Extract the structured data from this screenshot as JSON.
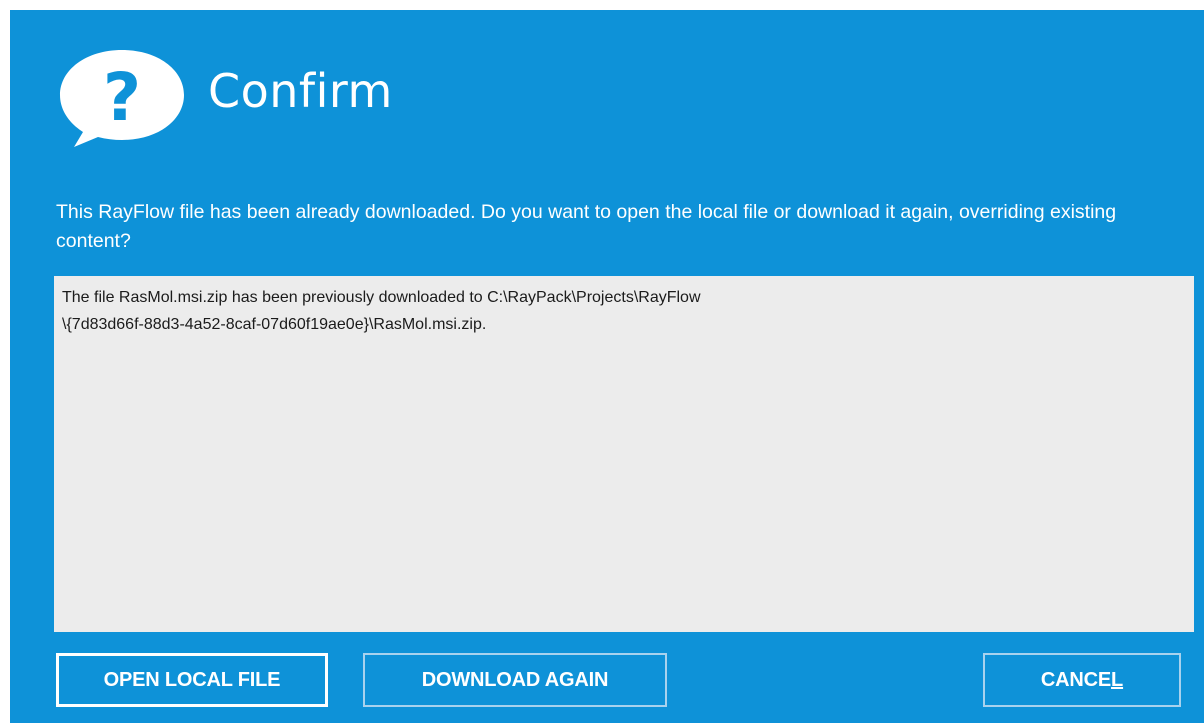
{
  "dialog": {
    "title": "Confirm",
    "icon": "question-speech-bubble-icon",
    "message": "This RayFlow file has been already downloaded. Do you want to open the local file or download it again, overriding existing content?",
    "details_line1": "The file RasMol.msi.zip has been previously downloaded to C:\\RayPack\\Projects\\RayFlow",
    "details_line2": "\\{7d83d66f-88d3-4a52-8caf-07d60f19ae0e}\\RasMol.msi.zip."
  },
  "buttons": {
    "open_local_file": "OPEN LOCAL FILE",
    "download_again": "DOWNLOAD AGAIN",
    "cancel_prefix": "CANCE",
    "cancel_mnemonic": "L"
  },
  "colors": {
    "background": "#0e92d8",
    "details_background": "#ececec",
    "text": "#ffffff"
  }
}
